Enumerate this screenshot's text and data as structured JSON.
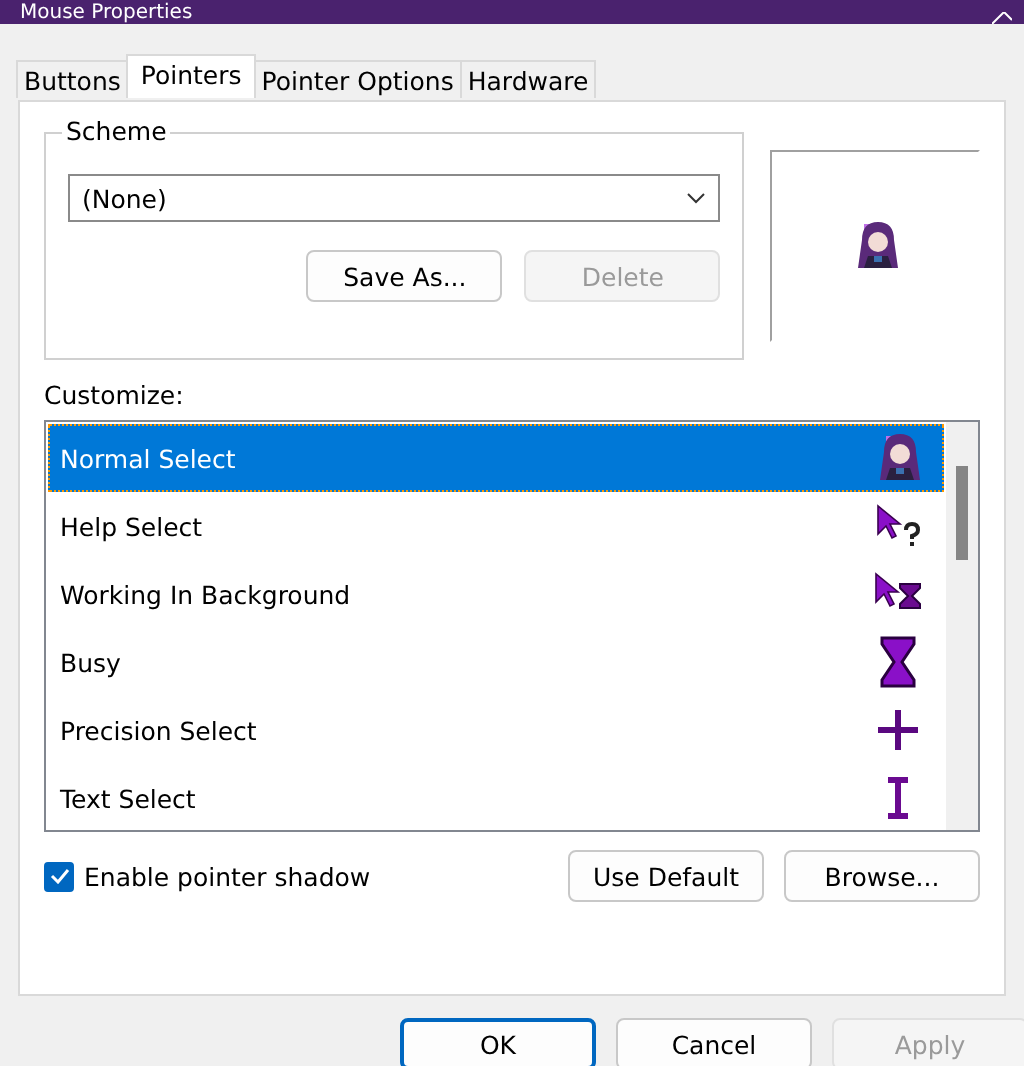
{
  "window": {
    "title": "Mouse Properties"
  },
  "tabs": [
    {
      "label": "Buttons",
      "selected": false
    },
    {
      "label": "Pointers",
      "selected": true
    },
    {
      "label": "Pointer Options",
      "selected": false
    },
    {
      "label": "Hardware",
      "selected": false
    }
  ],
  "scheme": {
    "label": "Scheme",
    "value": "(None)",
    "preview": {
      "kind": "figure"
    },
    "buttons": [
      {
        "label": "Save As...",
        "disabled": false
      },
      {
        "label": "Delete",
        "disabled": true
      }
    ]
  },
  "customize": {
    "label": "Customize:",
    "items": [
      {
        "name": "Normal Select",
        "kind": "figure",
        "selected": true
      },
      {
        "name": "Help Select",
        "kind": "help",
        "selected": false
      },
      {
        "name": "Working In Background",
        "kind": "working",
        "selected": false
      },
      {
        "name": "Busy",
        "kind": "busy",
        "selected": false
      },
      {
        "name": "Precision Select",
        "kind": "precision",
        "selected": false
      },
      {
        "name": "Text Select",
        "kind": "text",
        "selected": false
      }
    ]
  },
  "pointer_shadow": {
    "label": "Enable pointer shadow",
    "checked": true
  },
  "list_buttons": [
    {
      "label": "Use Default"
    },
    {
      "label": "Browse..."
    }
  ],
  "footer_buttons": [
    {
      "label": "OK",
      "default": true,
      "disabled": false
    },
    {
      "label": "Cancel",
      "default": false,
      "disabled": false
    },
    {
      "label": "Apply",
      "default": false,
      "disabled": true
    }
  ]
}
